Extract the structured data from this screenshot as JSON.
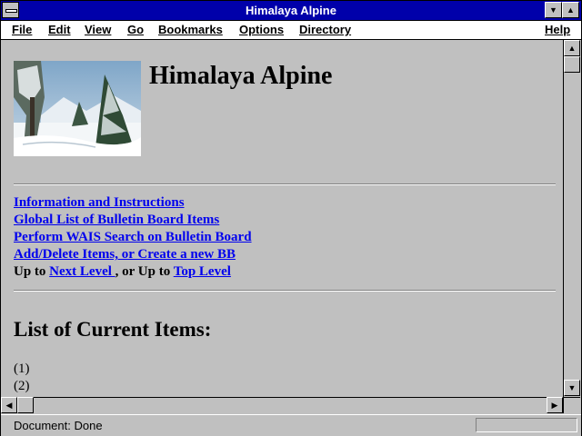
{
  "window": {
    "title": "Himalaya Alpine"
  },
  "menu": {
    "items": [
      {
        "label": "File"
      },
      {
        "label": "Edit"
      },
      {
        "label": "View"
      },
      {
        "label": "Go"
      },
      {
        "label": "Bookmarks"
      },
      {
        "label": "Options"
      },
      {
        "label": "Directory"
      },
      {
        "label": "Help"
      }
    ]
  },
  "page": {
    "heading": "Himalaya Alpine",
    "links": [
      {
        "label": "Information and Instructions"
      },
      {
        "label": "Global List of Bulletin Board Items"
      },
      {
        "label": "Perform WAIS Search on Bulletin Board"
      },
      {
        "label": "Add/Delete Items, or Create a new BB"
      }
    ],
    "nav": {
      "up_to": "Up to",
      "next_level": "Next Level ",
      "or_up_to": ", or Up to",
      "top_level": "Top Level "
    },
    "list_heading": "List of Current Items:",
    "items": [
      "(1)",
      "(2)"
    ]
  },
  "status": {
    "text": "Document: Done"
  },
  "colors": {
    "titlebar": "#0000aa",
    "link": "#0000ee",
    "chrome": "#c0c0c0"
  }
}
